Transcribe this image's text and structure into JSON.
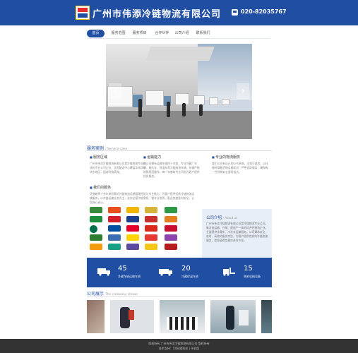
{
  "header": {
    "logo_text": "伟添",
    "company_name": "广州市伟添冷链物流有限公司",
    "phone_icon": "phone-icon",
    "phone": "020-82035767"
  },
  "nav": {
    "items": [
      {
        "label": "首页",
        "active": true
      },
      {
        "label": "服务范围",
        "active": false
      },
      {
        "label": "服务项目",
        "active": false
      },
      {
        "label": "合作伙伴",
        "active": false
      },
      {
        "label": "公司介绍",
        "active": false
      },
      {
        "label": "联系我们",
        "active": false
      }
    ]
  },
  "banner": {
    "prev_icon": "chevron-left-icon",
    "next_icon": "chevron-right-icon",
    "prev_label": "‹",
    "next_label": "›"
  },
  "services": {
    "title": "服务案例",
    "title_en": "/ Service case",
    "columns": [
      {
        "heading": "服务区域",
        "text": "广州市伟添冷链物流有限公司是冷链物流专业物流的专业公司企业，全国配送中心覆盖华南华中华东地区，配送时效高效。"
      },
      {
        "heading": "运输能力",
        "text": "本公司拥有运输车辆四十余部，专业冷藏厂车辆、厢式车、保温车等冷链物流车辆，车辆严格按照规范操作，每一车都有专业司机为客户提供优质服务。"
      },
      {
        "heading": "专业的物流服务",
        "text": "我们公司有自己的GPS系统，全程可追踪，以往随时掌握货物运输状况，严密追踪服务，确保每一件货物安全准时送达。"
      }
    ],
    "partner_heading": "我们的服务",
    "partner_text": "凭借着将十余年来积累的冷链物流运输管理经验与专业能力，为客户提供优质冷链物流运输服务，以冷链运输业务为主，支持全国冷链零担、整车业务等，配送快速准时安全，让您放心省心。"
  },
  "about": {
    "title": "公司介绍",
    "title_en": "/ About us",
    "text": "广州市伟添冷链物流有限公司是冷链物流专业公司，集冷链运输、仓储、配送于一体的综合性物流企业。主要提供冷藏车、冷冻车运输服务，公司秉承安全、准时、高效的服务宗旨，为客户提供优质的冷链物流服务，是您值得信赖的合作伙伴。"
  },
  "stats": [
    {
      "icon": "truck-icon",
      "number": "45",
      "label": "冷藏车辆运输车辆"
    },
    {
      "icon": "van-icon",
      "number": "20",
      "label": "冷藏保温车辆"
    },
    {
      "icon": "forklift-icon",
      "number": "15",
      "label": "装卸机械设备"
    }
  ],
  "gallery": {
    "title": "公司展示",
    "title_en": "The company shows"
  },
  "footer": {
    "line1": "版权所有 广州市伟添冷链物流有限公司 版权所有",
    "line2": "技术支持：XX网络科技 | 手机版"
  },
  "colors": {
    "brand": "#1f4ea3",
    "footer": "#333333"
  }
}
